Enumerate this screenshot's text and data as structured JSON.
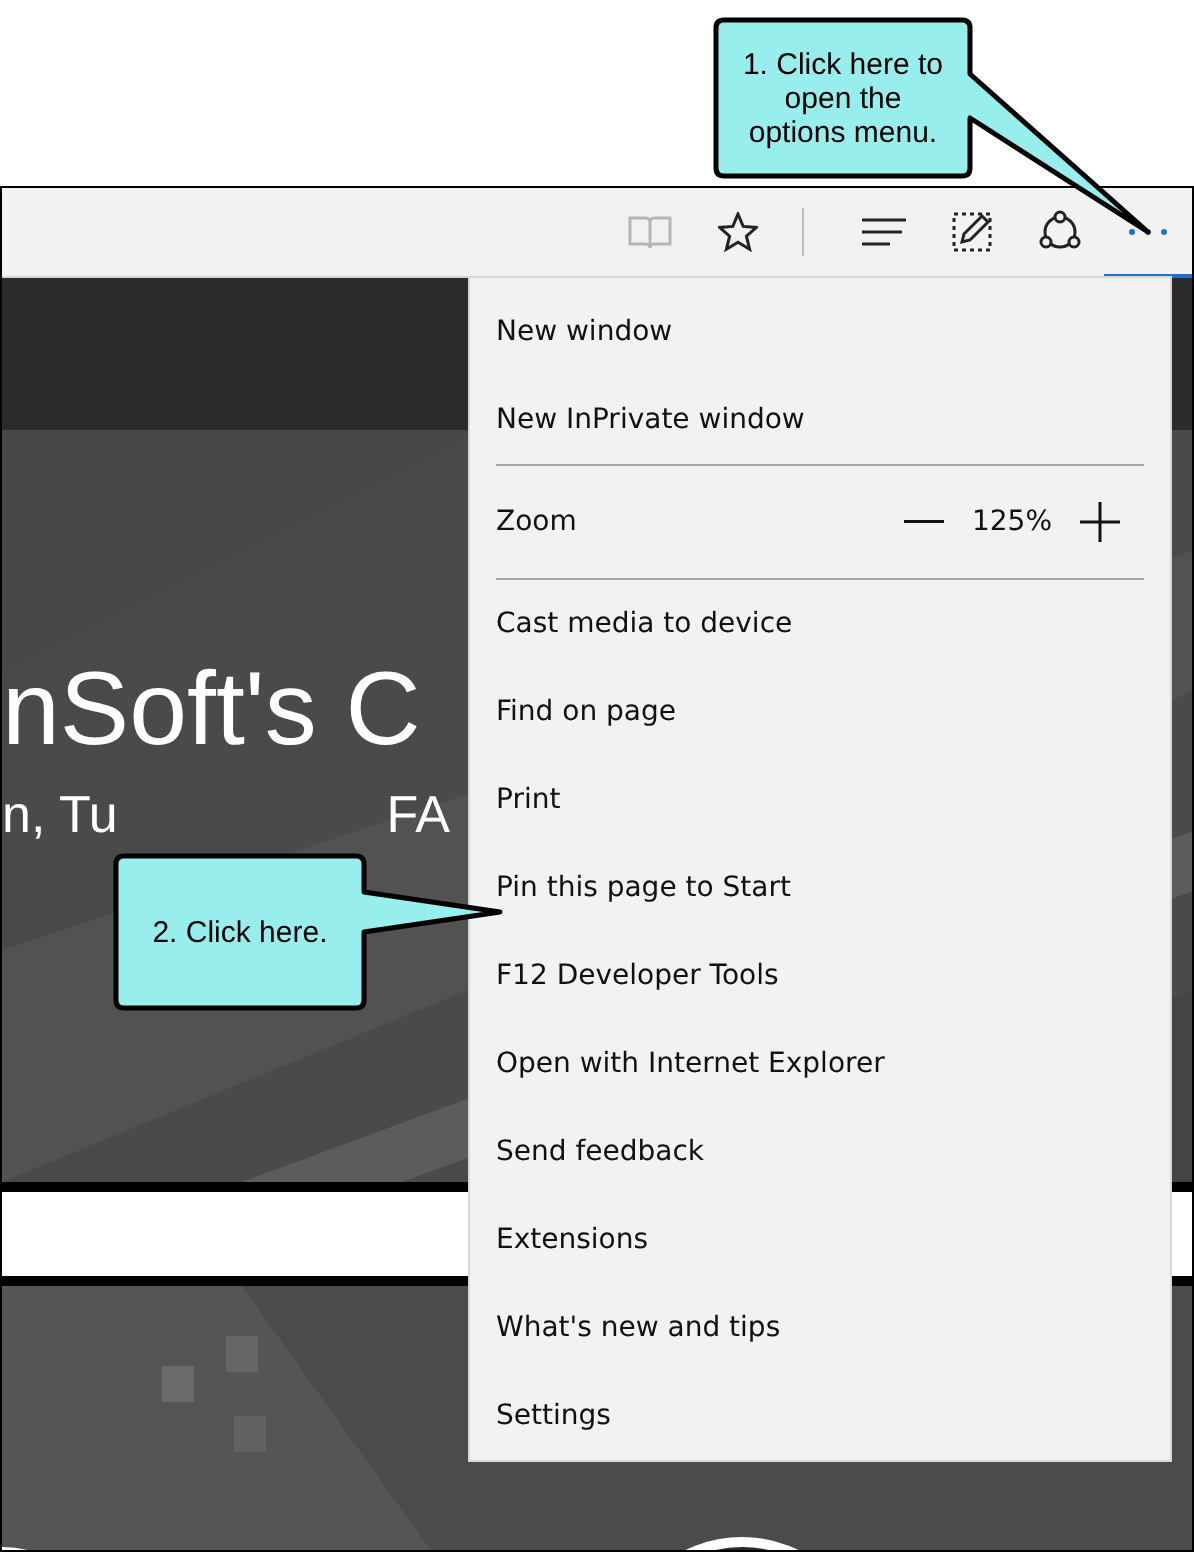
{
  "toolbar": {
    "buttons": [
      {
        "kind": "reading",
        "disabled": true,
        "selected": false
      },
      {
        "kind": "favorite",
        "disabled": false,
        "selected": false
      },
      {
        "kind": "hub",
        "disabled": false,
        "selected": false
      },
      {
        "kind": "note",
        "disabled": false,
        "selected": false
      },
      {
        "kind": "share",
        "disabled": false,
        "selected": false
      },
      {
        "kind": "more",
        "disabled": false,
        "selected": true
      }
    ]
  },
  "page": {
    "headline": "nSoft's C",
    "subtitle_left": "n, Tu",
    "subtitle_right": "FA"
  },
  "menu": {
    "items": [
      {
        "kind": "item",
        "label": "New window"
      },
      {
        "kind": "item",
        "label": "New InPrivate window"
      },
      {
        "kind": "divider"
      },
      {
        "kind": "zoom",
        "label": "Zoom",
        "value": "125%"
      },
      {
        "kind": "divider"
      },
      {
        "kind": "item",
        "label": "Cast media to device"
      },
      {
        "kind": "item",
        "label": "Find on page"
      },
      {
        "kind": "item",
        "label": "Print"
      },
      {
        "kind": "item",
        "label": "Pin this page to Start"
      },
      {
        "kind": "item",
        "label": "F12 Developer Tools"
      },
      {
        "kind": "item",
        "label": "Open with Internet Explorer"
      },
      {
        "kind": "item",
        "label": "Send feedback"
      },
      {
        "kind": "item",
        "label": "Extensions"
      },
      {
        "kind": "item",
        "label": "What's new and tips"
      },
      {
        "kind": "item",
        "label": "Settings"
      }
    ]
  },
  "callouts": [
    {
      "text": "1. Click here to open the options menu."
    },
    {
      "text": "2. Click here."
    }
  ]
}
